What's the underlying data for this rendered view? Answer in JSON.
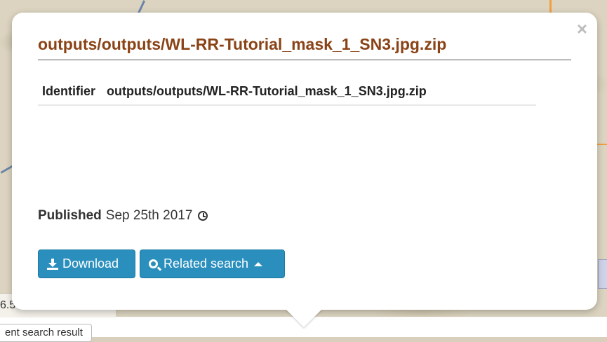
{
  "popup": {
    "title": "outputs/outputs/WL-RR-Tutorial_mask_1_SN3.jpg.zip",
    "close_label": "×",
    "identifier_label": "Identifier",
    "identifier_value": "outputs/outputs/WL-RR-Tutorial_mask_1_SN3.jpg.zip",
    "published_label": "Published",
    "published_value": "Sep 25th 2017",
    "download_label": "Download",
    "related_search_label": "Related search"
  },
  "background": {
    "coord_text": "6.5",
    "result_button_label": "ent search result"
  },
  "colors": {
    "title": "#8a4316",
    "button": "#2a8fbd"
  },
  "icons": [
    "close-icon",
    "clock-icon",
    "download-icon",
    "search-icon",
    "caret-up-icon"
  ]
}
